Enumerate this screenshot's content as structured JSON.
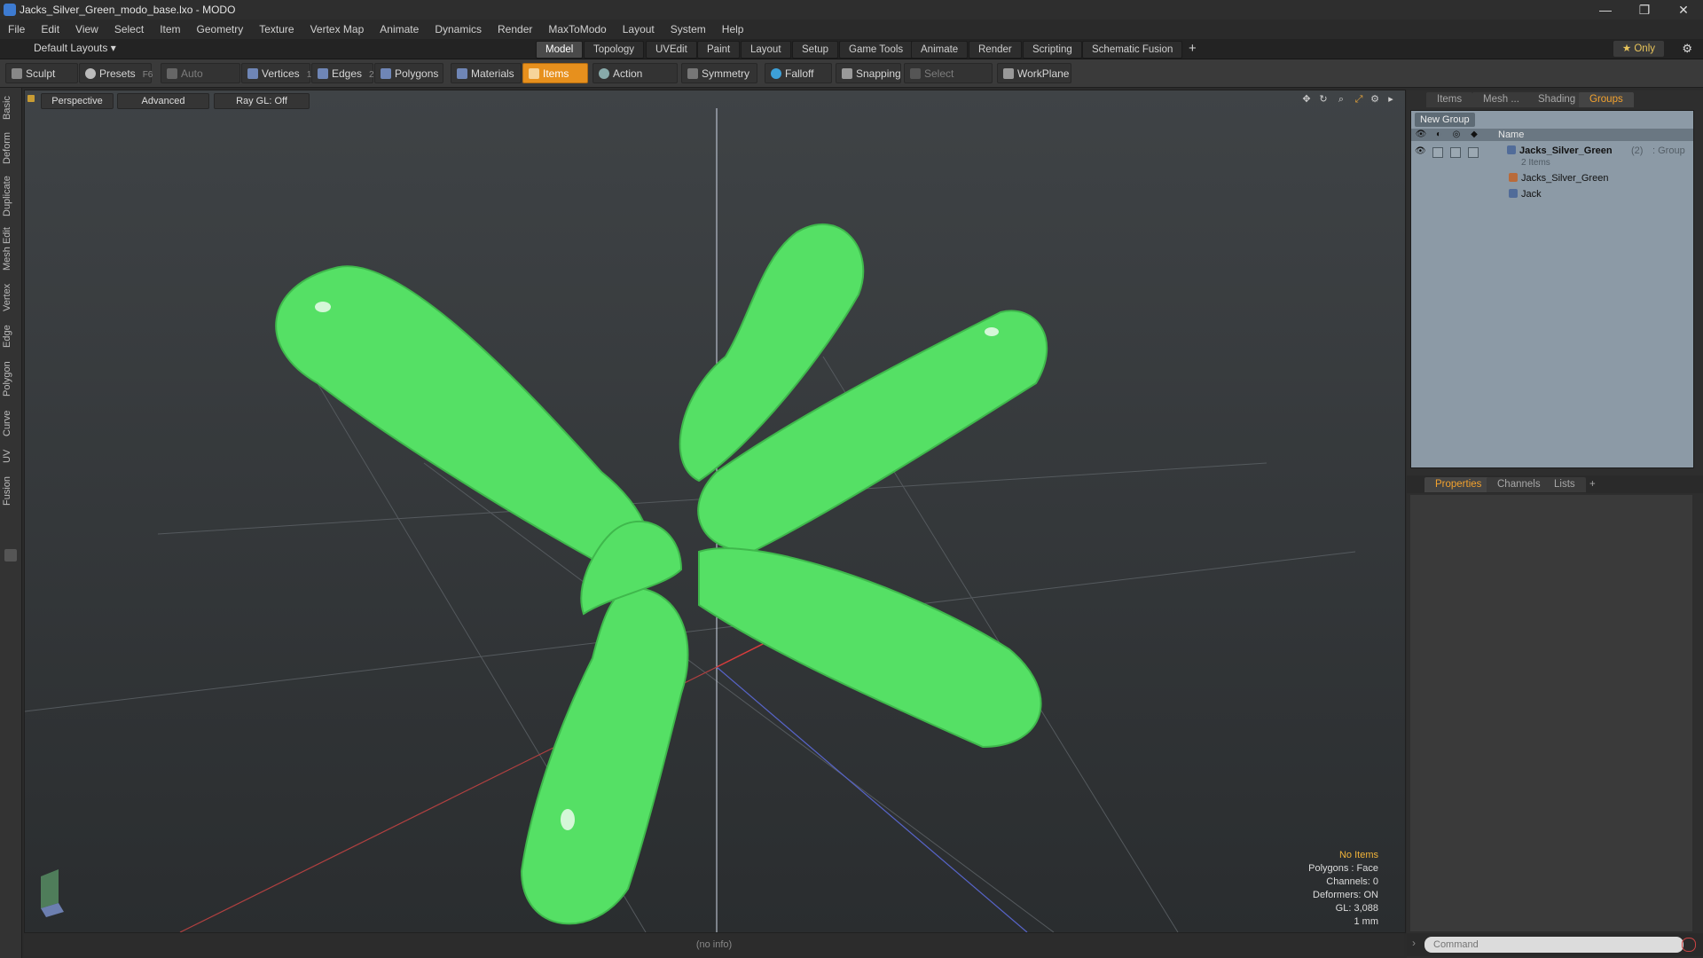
{
  "window": {
    "title": "Jacks_Silver_Green_modo_base.lxo - MODO",
    "controls": [
      "—",
      "❐",
      "✕"
    ]
  },
  "menu": [
    "File",
    "Edit",
    "View",
    "Select",
    "Item",
    "Geometry",
    "Texture",
    "Vertex Map",
    "Animate",
    "Dynamics",
    "Render",
    "MaxToModo",
    "Layout",
    "System",
    "Help"
  ],
  "layout_bar": {
    "layouts_label": "Default Layouts ▾",
    "tabs": [
      "Model",
      "Topology",
      "UVEdit",
      "Paint",
      "Layout",
      "Setup",
      "Game Tools",
      "Animate",
      "Render",
      "Scripting",
      "Schematic Fusion"
    ],
    "active_tab": "Model",
    "add_label": "+",
    "only_label": "★ Only",
    "gear_label": "⚙"
  },
  "toolbar": {
    "sculpt": "Sculpt",
    "presets": "Presets",
    "presets_key": "F6",
    "auto_select": "Auto Select",
    "vertices": "Vertices",
    "vertices_key": "1",
    "edges": "Edges",
    "edges_key": "2",
    "polygons": "Polygons",
    "materials": "Materials",
    "items": "Items",
    "action_center": "Action Center",
    "symmetry": "Symmetry",
    "falloff": "Falloff",
    "snapping": "Snapping",
    "select_through": "Select Through",
    "workplane": "WorkPlane"
  },
  "left_tabs": [
    "Basic",
    "Deform",
    "Duplicate",
    "Mesh Edit",
    "Vertex",
    "Edge",
    "Polygon",
    "Curve",
    "UV",
    "Fusion"
  ],
  "viewport": {
    "view_mode": "Perspective",
    "shading": "Advanced",
    "raygl": "Ray GL: Off",
    "mesh_color": "#55e065",
    "hud": {
      "selection": "No Items",
      "polygons": "Polygons : Face",
      "channels": "Channels: 0",
      "deformers": "Deformers: ON",
      "gl": "GL: 3,088",
      "unit": "1 mm"
    }
  },
  "status": "(no info)",
  "items_panel": {
    "tabs": [
      "Items",
      "Mesh ...",
      "Shading",
      "Groups"
    ],
    "active_tab": "Groups",
    "new_group": "New Group",
    "column_name": "Name",
    "group_name": "Jacks_Silver_Green",
    "group_count": "(2)",
    "group_type": ": Group",
    "group_sub": "2 Items",
    "children": [
      "Jacks_Silver_Green",
      "Jack"
    ]
  },
  "properties_panel": {
    "tabs": [
      "Properties",
      "Channels",
      "Lists"
    ],
    "active_tab": "Properties",
    "add_label": "+"
  },
  "command": {
    "placeholder": "Command"
  },
  "colors": {
    "accent": "#e7901d",
    "active_tab_text": "#f3a22e"
  }
}
